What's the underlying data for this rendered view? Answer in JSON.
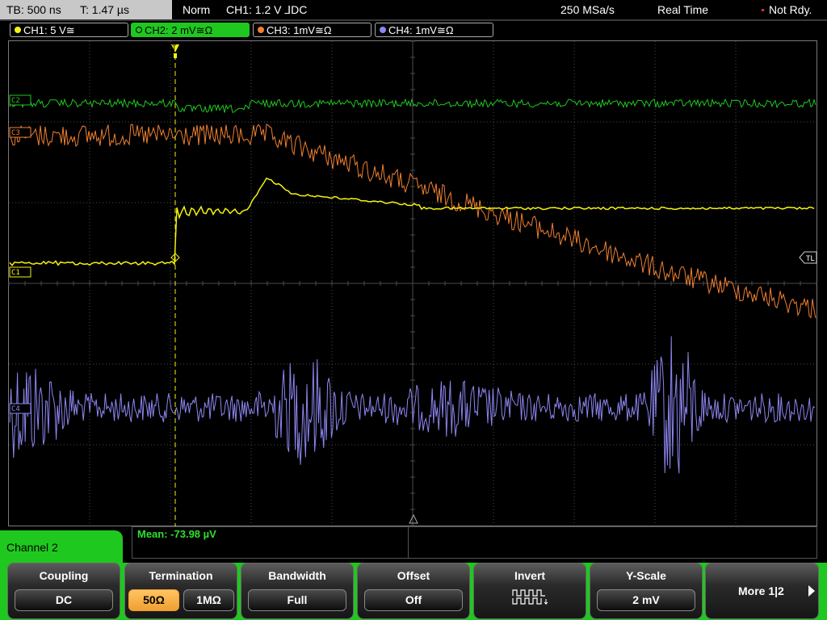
{
  "status_bar": {
    "timebase": "TB: 500 ns",
    "trigger_time": "T: 1.47 µs",
    "acquisition_mode": "Norm",
    "trigger_info": "CH1: 1.2 V ⅃DC",
    "sample_rate": "250 MSa/s",
    "mode": "Real Time",
    "trigger_status": "Not Rdy."
  },
  "channel_tabs": [
    {
      "label": "CH1: 5 V≅",
      "color": "#f4f40e",
      "active": false
    },
    {
      "label": "CH2: 2 mV≅Ω",
      "color": "#1fc81f",
      "active": true
    },
    {
      "label": "CH3: 1mV≅Ω",
      "color": "#f08030",
      "active": false
    },
    {
      "label": "CH4: 1mV≅Ω",
      "color": "#8c86f0",
      "active": false
    }
  ],
  "markers": {
    "ch1": "C1",
    "ch2": "C2",
    "ch3": "C3",
    "ch4": "C4",
    "trigger_level": "TL",
    "trigger_position": "T"
  },
  "measurement": {
    "text": "Mean: -73.98 µV"
  },
  "menu": {
    "title": "Channel 2",
    "softkeys": [
      {
        "title": "Coupling",
        "value": "DC"
      },
      {
        "title": "Termination",
        "options": [
          "50Ω",
          "1MΩ"
        ],
        "selected": "50Ω"
      },
      {
        "title": "Bandwidth",
        "value": "Full"
      },
      {
        "title": "Offset",
        "value": "Off"
      },
      {
        "title": "Invert",
        "icon": "invert-waveform-icon"
      },
      {
        "title": "Y-Scale",
        "value": "2 mV"
      }
    ],
    "more": "More 1|2"
  },
  "colors": {
    "ch1": "#f4f40e",
    "ch2": "#1fc81f",
    "ch3": "#f08030",
    "ch4": "#8c86f0",
    "grid": "#4a4a4a",
    "menu_accent": "#1fc81f",
    "selected_option": "#f0a030"
  }
}
